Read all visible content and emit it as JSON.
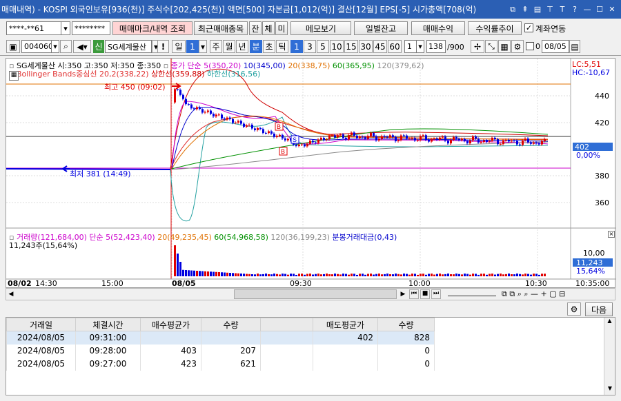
{
  "window": {
    "title": "매매내역) - KOSPI 외국인보유[936(천)] 주식수[202,425(천)] 액면[500] 자본금[1,012(억)] 결산[12월] EPS[-5] 시가총액[708(억)"
  },
  "toolbar1": {
    "account": "****-**61",
    "password": "********",
    "mark_label": "매매마크/내역 조회",
    "recent_label": "최근매매종목",
    "tab_jan": "잔",
    "tab_che": "체",
    "tab_mi": "미",
    "memo_label": "메모보기",
    "daily_balance_label": "일별잔고",
    "trade_profit_label": "매매수익",
    "profit_trend_label": "수익률추이",
    "account_link_label": "계좌연동"
  },
  "toolbar2": {
    "code": "004060",
    "badge": "신",
    "name": "SG세계물산",
    "excl": "!",
    "period_day": "일",
    "period_num": "1",
    "periods": [
      "주",
      "월",
      "년",
      "분",
      "초",
      "틱"
    ],
    "minutes": [
      "1",
      "3",
      "5",
      "10",
      "15",
      "30",
      "45",
      "60"
    ],
    "minute_sel": "1",
    "count": "138",
    "total": "/900",
    "zero_flag": "0",
    "date": "08/05"
  },
  "chart": {
    "price_legend": "SG세계물산 시:350 고:350 저:350 종:350",
    "ma_title": "종가 단순 5(350,20)",
    "ma10": "10(345,00)",
    "ma20": "20(338,75)",
    "ma60": "60(365,95)",
    "ma120": "120(379,62)",
    "bb_mid": "Bollinger Bands중심선 20,2(338,22)",
    "bb_upper": "상한선(359,88)",
    "bb_lower": "하한선(316,56)",
    "lc": "LC:5,51",
    "hc": "HC:-10,67",
    "high_label": "최고 450 (09:02)",
    "low_label": "최저 381 (14:49)",
    "y_ticks": [
      "440",
      "420",
      "380",
      "360"
    ],
    "current_price": "402",
    "current_pct": "0,00%",
    "vol_legend": "거래량(121,684,00)",
    "vol_ma5": "단순 5(52,423,40)",
    "vol_ma20": "20(49,235,45)",
    "vol_ma60": "60(54,968,58)",
    "vol_ma120": "120(36,199,23)",
    "vol_amount": "분봉거래대금(0,43)",
    "vol_current": "11,243주(15,64%)",
    "vol_tick": "10,00",
    "vol_value": "11,243",
    "vol_pct": "15,64%",
    "x_labels": [
      "08/02",
      "14:30",
      "15:00",
      "08/05",
      "09:30",
      "10:00",
      "10:30",
      "10:35:00"
    ],
    "colors": {
      "up": "#e00000",
      "down": "#0000e0",
      "ma5": "#cc00cc",
      "ma10": "#0000cc",
      "ma20": "#e07000",
      "ma60": "#009000",
      "ma120": "#888888"
    }
  },
  "bottom": {
    "next_label": "다음"
  },
  "table": {
    "headers": [
      "거래일",
      "체결시간",
      "매수평균가",
      "수량",
      "",
      "매도평균가",
      "수량"
    ],
    "rows": [
      [
        "2024/08/05",
        "09:31:00",
        "",
        "",
        "",
        "402",
        "828"
      ],
      [
        "2024/08/05",
        "09:28:00",
        "403",
        "207",
        "",
        "",
        "0"
      ],
      [
        "2024/08/05",
        "09:27:00",
        "423",
        "621",
        "",
        "",
        "0"
      ]
    ]
  }
}
